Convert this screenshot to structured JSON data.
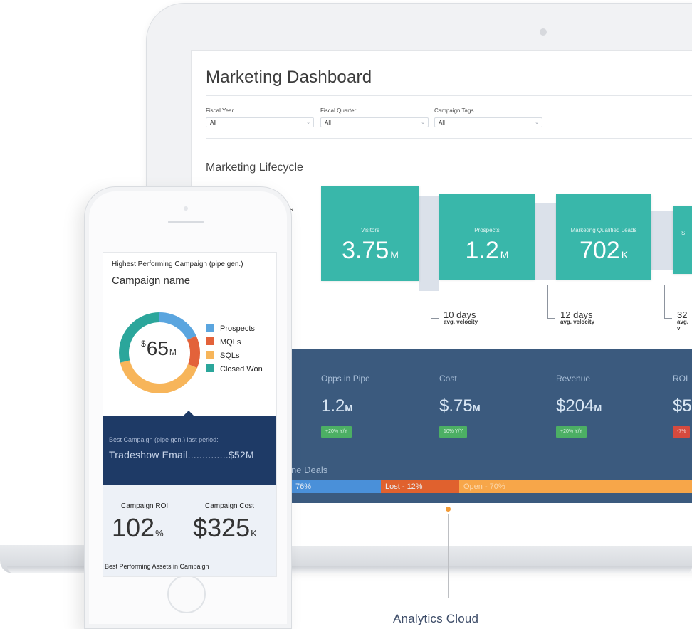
{
  "dashboard": {
    "title": "Marketing Dashboard",
    "filters": [
      {
        "label": "Fiscal Year",
        "value": "All"
      },
      {
        "label": "Fiscal Quarter",
        "value": "All"
      },
      {
        "label": "Campaign Tags",
        "value": "All"
      }
    ],
    "section_title": "Marketing Lifecycle",
    "side_label_fragment": "ads",
    "stages": [
      {
        "label": "Visitors",
        "value": "3.75",
        "unit": "M"
      },
      {
        "label": "Prospects",
        "value": "1.2",
        "unit": "M"
      },
      {
        "label": "Marketing Qualified Leads",
        "value": "702",
        "unit": "K"
      },
      {
        "label": "S",
        "value": "",
        "unit": ""
      }
    ],
    "velocities": [
      {
        "days": "10 days",
        "caption": "avg. velocity"
      },
      {
        "days": "12 days",
        "caption": "avg. velocity"
      },
      {
        "days": "32",
        "caption": "avg. v"
      }
    ],
    "kpis": [
      {
        "label": "Opps in Pipe",
        "value": "1.2",
        "unit": "M",
        "badge": "+20% Y/Y",
        "badge_status": "up"
      },
      {
        "label": "Cost",
        "value": "$.75",
        "unit": "M",
        "badge": "10% Y/Y",
        "badge_status": "up"
      },
      {
        "label": "Revenue",
        "value": "$204",
        "unit": "M",
        "badge": "+20% Y/Y",
        "badge_status": "up"
      },
      {
        "label": "ROI",
        "value": "$5",
        "unit": "",
        "badge": "-7%",
        "badge_status": "down"
      }
    ],
    "deals_label": "ne Deals",
    "deals_bar": [
      {
        "label": "76%",
        "color": "#4a90d9"
      },
      {
        "label": "Lost - 12%",
        "color": "#e0612e"
      },
      {
        "label": "Open - 70%",
        "color": "#f7a649"
      }
    ],
    "colors": {
      "teal": "#39b7aa",
      "navy": "#3b5a7e",
      "green": "#4caf64",
      "red": "#d54a3e"
    }
  },
  "phone": {
    "header_caption": "Highest Performing Campaign (pipe gen.)",
    "campaign_name": "Campaign name",
    "donut": {
      "center_prefix": "$",
      "center_value": "65",
      "center_unit": "M",
      "legend": [
        {
          "label": "Prospects",
          "color": "#5aa5df"
        },
        {
          "label": "MQLs",
          "color": "#e3623a"
        },
        {
          "label": "SQLs",
          "color": "#f7b55a"
        },
        {
          "label": "Closed Won",
          "color": "#2ba69b"
        }
      ]
    },
    "best_last_caption": "Best Campaign (pipe gen.) last period:",
    "best_last_value": "Tradeshow Email..............$52M",
    "roi_label": "Campaign ROI",
    "roi_value": "102",
    "roi_unit": "%",
    "cost_label": "Campaign Cost",
    "cost_value": "$325",
    "cost_unit": "K",
    "assets_label": "Best Performing Assets in Campaign"
  },
  "callout": {
    "label": "Analytics Cloud"
  }
}
